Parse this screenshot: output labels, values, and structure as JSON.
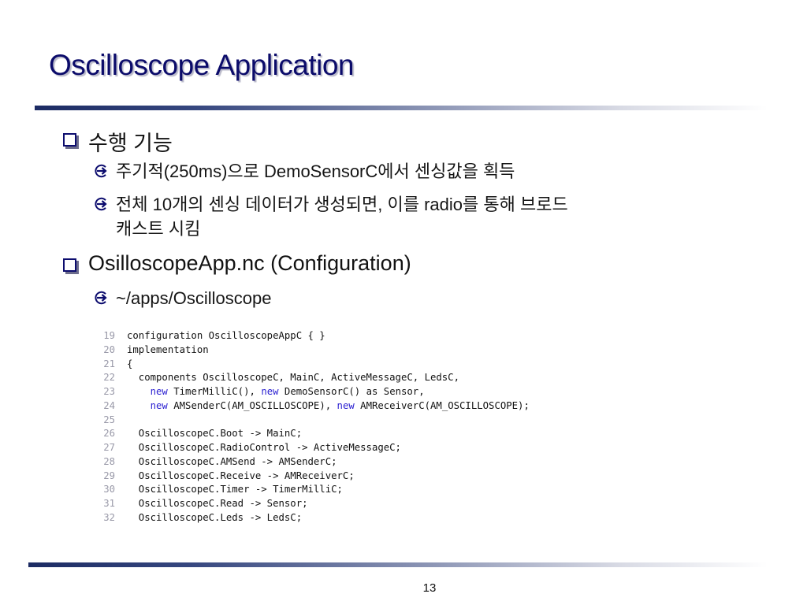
{
  "slide": {
    "title": "Oscilloscope Application",
    "page_number": "13"
  },
  "bullets": [
    {
      "text": "수행 기능",
      "sub": [
        {
          "text": "주기적(250ms)으로 DemoSensorC에서 센싱값을 획득"
        },
        {
          "text": "전체 10개의 센싱 데이터가 생성되면, 이를 radio를 통해 브로드",
          "continuation": "캐스트 시킴"
        }
      ]
    },
    {
      "text": "OsilloscopeApp.nc (Configuration)",
      "sub": [
        {
          "text": "~/apps/Oscilloscope"
        }
      ]
    }
  ],
  "code": {
    "lines": [
      {
        "num": "19",
        "segments": [
          {
            "text": "configuration OscilloscopeAppC { }"
          }
        ]
      },
      {
        "num": "20",
        "segments": [
          {
            "text": "implementation"
          }
        ]
      },
      {
        "num": "21",
        "segments": [
          {
            "text": "{"
          }
        ]
      },
      {
        "num": "22",
        "segments": [
          {
            "text": "  components OscilloscopeC, MainC, ActiveMessageC, LedsC,"
          }
        ]
      },
      {
        "num": "23",
        "segments": [
          {
            "text": "    "
          },
          {
            "text": "new",
            "kw": true
          },
          {
            "text": " TimerMilliC(), "
          },
          {
            "text": "new",
            "kw": true
          },
          {
            "text": " DemoSensorC() as Sensor,"
          }
        ]
      },
      {
        "num": "24",
        "segments": [
          {
            "text": "    "
          },
          {
            "text": "new",
            "kw": true
          },
          {
            "text": " AMSenderC(AM_OSCILLOSCOPE), "
          },
          {
            "text": "new",
            "kw": true
          },
          {
            "text": " AMReceiverC(AM_OSCILLOSCOPE);"
          }
        ]
      },
      {
        "num": "25",
        "segments": [
          {
            "text": ""
          }
        ]
      },
      {
        "num": "26",
        "segments": [
          {
            "text": "  OscilloscopeC.Boot -> MainC;"
          }
        ]
      },
      {
        "num": "27",
        "segments": [
          {
            "text": "  OscilloscopeC.RadioControl -> ActiveMessageC;"
          }
        ]
      },
      {
        "num": "28",
        "segments": [
          {
            "text": "  OscilloscopeC.AMSend -> AMSenderC;"
          }
        ]
      },
      {
        "num": "29",
        "segments": [
          {
            "text": "  OscilloscopeC.Receive -> AMReceiverC;"
          }
        ]
      },
      {
        "num": "30",
        "segments": [
          {
            "text": "  OscilloscopeC.Timer -> TimerMilliC;"
          }
        ]
      },
      {
        "num": "31",
        "segments": [
          {
            "text": "  OscilloscopeC.Read -> Sensor;"
          }
        ]
      },
      {
        "num": "32",
        "segments": [
          {
            "text": "  OscilloscopeC.Leds -> LedsC;"
          }
        ]
      }
    ]
  }
}
